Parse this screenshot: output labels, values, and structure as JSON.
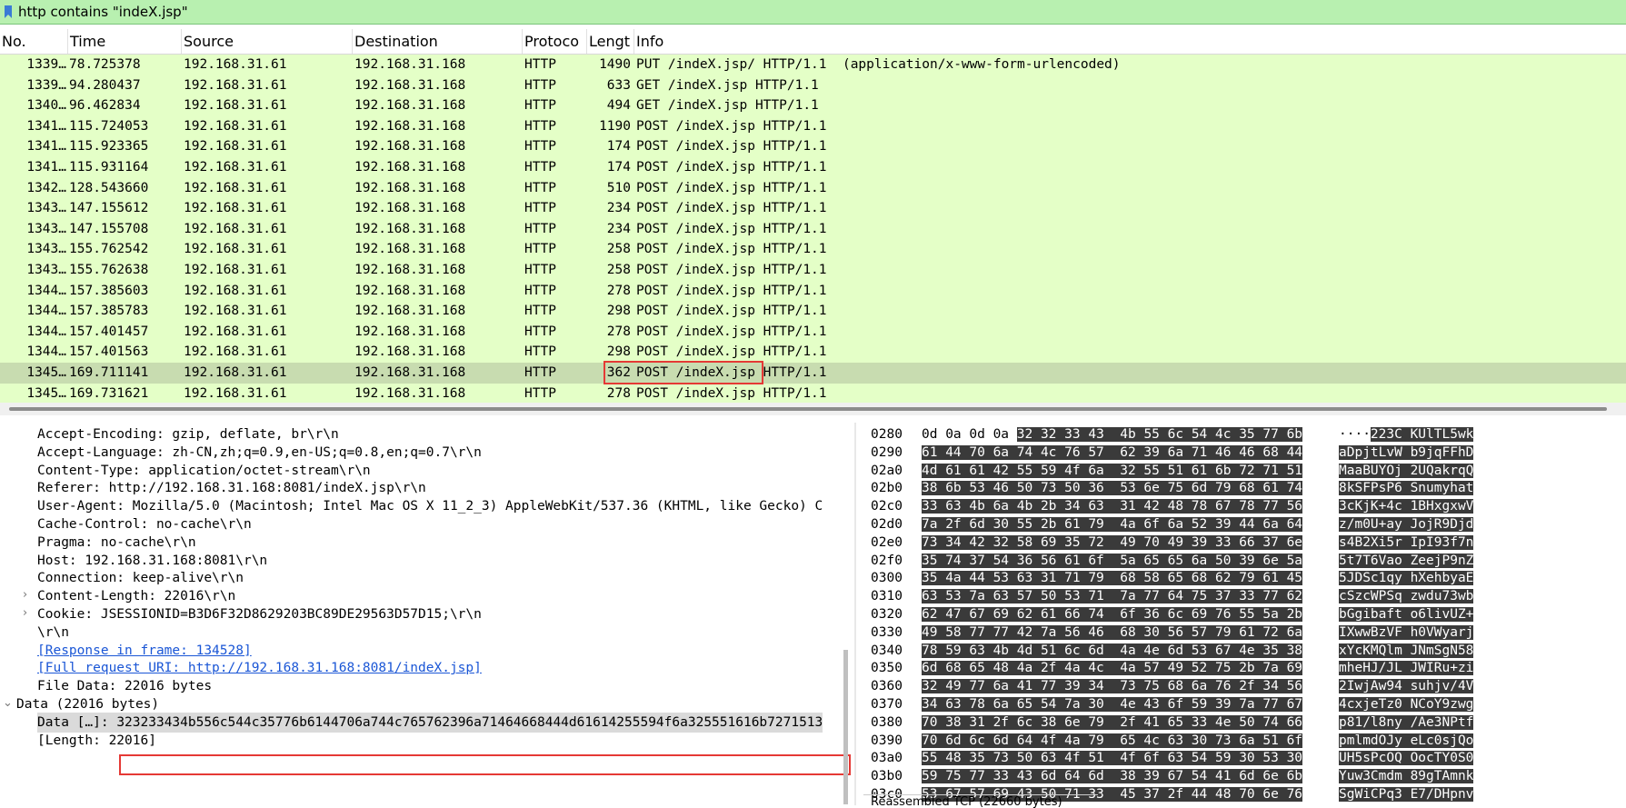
{
  "filter": {
    "text": "http contains \"indeX.jsp\""
  },
  "columns": [
    "No.",
    "Time",
    "Source",
    "Destination",
    "Protoco",
    "Lengt",
    "Info"
  ],
  "packets": [
    {
      "no": "1339…",
      "time": "78.725378",
      "src": "192.168.31.61",
      "dst": "192.168.31.168",
      "proto": "HTTP",
      "len": "1490",
      "info": "PUT /indeX.jsp/ HTTP/1.1  (application/x-www-form-urlencoded)"
    },
    {
      "no": "1339…",
      "time": "94.280437",
      "src": "192.168.31.61",
      "dst": "192.168.31.168",
      "proto": "HTTP",
      "len": "633",
      "info": "GET /indeX.jsp HTTP/1.1"
    },
    {
      "no": "1340…",
      "time": "96.462834",
      "src": "192.168.31.61",
      "dst": "192.168.31.168",
      "proto": "HTTP",
      "len": "494",
      "info": "GET /indeX.jsp HTTP/1.1"
    },
    {
      "no": "1341…",
      "time": "115.724053",
      "src": "192.168.31.61",
      "dst": "192.168.31.168",
      "proto": "HTTP",
      "len": "1190",
      "info": "POST /indeX.jsp HTTP/1.1"
    },
    {
      "no": "1341…",
      "time": "115.923365",
      "src": "192.168.31.61",
      "dst": "192.168.31.168",
      "proto": "HTTP",
      "len": "174",
      "info": "POST /indeX.jsp HTTP/1.1"
    },
    {
      "no": "1341…",
      "time": "115.931164",
      "src": "192.168.31.61",
      "dst": "192.168.31.168",
      "proto": "HTTP",
      "len": "174",
      "info": "POST /indeX.jsp HTTP/1.1"
    },
    {
      "no": "1342…",
      "time": "128.543660",
      "src": "192.168.31.61",
      "dst": "192.168.31.168",
      "proto": "HTTP",
      "len": "510",
      "info": "POST /indeX.jsp HTTP/1.1"
    },
    {
      "no": "1343…",
      "time": "147.155612",
      "src": "192.168.31.61",
      "dst": "192.168.31.168",
      "proto": "HTTP",
      "len": "234",
      "info": "POST /indeX.jsp HTTP/1.1"
    },
    {
      "no": "1343…",
      "time": "147.155708",
      "src": "192.168.31.61",
      "dst": "192.168.31.168",
      "proto": "HTTP",
      "len": "234",
      "info": "POST /indeX.jsp HTTP/1.1"
    },
    {
      "no": "1343…",
      "time": "155.762542",
      "src": "192.168.31.61",
      "dst": "192.168.31.168",
      "proto": "HTTP",
      "len": "258",
      "info": "POST /indeX.jsp HTTP/1.1"
    },
    {
      "no": "1343…",
      "time": "155.762638",
      "src": "192.168.31.61",
      "dst": "192.168.31.168",
      "proto": "HTTP",
      "len": "258",
      "info": "POST /indeX.jsp HTTP/1.1"
    },
    {
      "no": "1344…",
      "time": "157.385603",
      "src": "192.168.31.61",
      "dst": "192.168.31.168",
      "proto": "HTTP",
      "len": "278",
      "info": "POST /indeX.jsp HTTP/1.1"
    },
    {
      "no": "1344…",
      "time": "157.385783",
      "src": "192.168.31.61",
      "dst": "192.168.31.168",
      "proto": "HTTP",
      "len": "298",
      "info": "POST /indeX.jsp HTTP/1.1"
    },
    {
      "no": "1344…",
      "time": "157.401457",
      "src": "192.168.31.61",
      "dst": "192.168.31.168",
      "proto": "HTTP",
      "len": "278",
      "info": "POST /indeX.jsp HTTP/1.1"
    },
    {
      "no": "1344…",
      "time": "157.401563",
      "src": "192.168.31.61",
      "dst": "192.168.31.168",
      "proto": "HTTP",
      "len": "298",
      "info": "POST /indeX.jsp HTTP/1.1"
    },
    {
      "no": "1345…",
      "time": "169.711141",
      "src": "192.168.31.61",
      "dst": "192.168.31.168",
      "proto": "HTTP",
      "len": "362",
      "info": "POST /indeX.jsp HTTP/1.1",
      "selected": true
    },
    {
      "no": "1345…",
      "time": "169.731621",
      "src": "192.168.31.61",
      "dst": "192.168.31.168",
      "proto": "HTTP",
      "len": "278",
      "info": "POST /indeX.jsp HTTP/1.1"
    }
  ],
  "details": [
    {
      "indent": 1,
      "text": "Accept-Encoding: gzip, deflate, br\\r\\n"
    },
    {
      "indent": 1,
      "text": "Accept-Language: zh-CN,zh;q=0.9,en-US;q=0.8,en;q=0.7\\r\\n"
    },
    {
      "indent": 1,
      "text": "Content-Type: application/octet-stream\\r\\n"
    },
    {
      "indent": 1,
      "text": "Referer: http://192.168.31.168:8081/indeX.jsp\\r\\n"
    },
    {
      "indent": 1,
      "text": "User-Agent: Mozilla/5.0 (Macintosh; Intel Mac OS X 11_2_3) AppleWebKit/537.36 (KHTML, like Gecko) C"
    },
    {
      "indent": 1,
      "text": "Cache-Control: no-cache\\r\\n"
    },
    {
      "indent": 1,
      "text": "Pragma: no-cache\\r\\n"
    },
    {
      "indent": 1,
      "text": "Host: 192.168.31.168:8081\\r\\n"
    },
    {
      "indent": 1,
      "text": "Connection: keep-alive\\r\\n"
    },
    {
      "indent": 1,
      "text": "Content-Length: 22016\\r\\n",
      "expander": "›"
    },
    {
      "indent": 1,
      "text": "Cookie: JSESSIONID=B3D6F32D8629203BC89DE29563D57D15;\\r\\n",
      "expander": "›"
    },
    {
      "indent": 1,
      "text": "\\r\\n"
    },
    {
      "indent": 1,
      "text": "[Response in frame: 134528]",
      "link": true
    },
    {
      "indent": 1,
      "text": "[Full request URI: http://192.168.31.168:8081/indeX.jsp]",
      "link": true
    },
    {
      "indent": 1,
      "text": "File Data: 22016 bytes"
    },
    {
      "indent": 0,
      "text": "Data (22016 bytes)",
      "expander": "⌄"
    },
    {
      "indent": 1,
      "text": "Data […]: ",
      "value": "323233434b556c544c35776b6144706a744c765762396a71464668444d61614255594f6a325551616b7271513",
      "selected": true
    },
    {
      "indent": 1,
      "text": "[Length: 22016]"
    }
  ],
  "hex": [
    {
      "off": "0280",
      "bytes": "0d 0a 0d 0a 32 32 33 43  4b 55 6c 54 4c 35 77 6b",
      "ascii": "····223C KUlTL5wk"
    },
    {
      "off": "0290",
      "bytes": "61 44 70 6a 74 4c 76 57  62 39 6a 71 46 46 68 44",
      "ascii": "aDpjtLvW b9jqFFhD"
    },
    {
      "off": "02a0",
      "bytes": "4d 61 61 42 55 59 4f 6a  32 55 51 61 6b 72 71 51",
      "ascii": "MaaBUYOj 2UQakrqQ"
    },
    {
      "off": "02b0",
      "bytes": "38 6b 53 46 50 73 50 36  53 6e 75 6d 79 68 61 74",
      "ascii": "8kSFPsP6 Snumyhat"
    },
    {
      "off": "02c0",
      "bytes": "33 63 4b 6a 4b 2b 34 63  31 42 48 78 67 78 77 56",
      "ascii": "3cKjK+4c 1BHxgxwV"
    },
    {
      "off": "02d0",
      "bytes": "7a 2f 6d 30 55 2b 61 79  4a 6f 6a 52 39 44 6a 64",
      "ascii": "z/m0U+ay JojR9Djd"
    },
    {
      "off": "02e0",
      "bytes": "73 34 42 32 58 69 35 72  49 70 49 39 33 66 37 6e",
      "ascii": "s4B2Xi5r IpI93f7n"
    },
    {
      "off": "02f0",
      "bytes": "35 74 37 54 36 56 61 6f  5a 65 65 6a 50 39 6e 5a",
      "ascii": "5t7T6Vao ZeejP9nZ"
    },
    {
      "off": "0300",
      "bytes": "35 4a 44 53 63 31 71 79  68 58 65 68 62 79 61 45",
      "ascii": "5JDSc1qy hXehbyaE"
    },
    {
      "off": "0310",
      "bytes": "63 53 7a 63 57 50 53 71  7a 77 64 75 37 33 77 62",
      "ascii": "cSzcWPSq zwdu73wb"
    },
    {
      "off": "0320",
      "bytes": "62 47 67 69 62 61 66 74  6f 36 6c 69 76 55 5a 2b",
      "ascii": "bGgibaft o6livUZ+"
    },
    {
      "off": "0330",
      "bytes": "49 58 77 77 42 7a 56 46  68 30 56 57 79 61 72 6a",
      "ascii": "IXwwBzVF h0VWyarj"
    },
    {
      "off": "0340",
      "bytes": "78 59 63 4b 4d 51 6c 6d  4a 4e 6d 53 67 4e 35 38",
      "ascii": "xYcKMQlm JNmSgN58"
    },
    {
      "off": "0350",
      "bytes": "6d 68 65 48 4a 2f 4a 4c  4a 57 49 52 75 2b 7a 69",
      "ascii": "mheHJ/JL JWIRu+zi"
    },
    {
      "off": "0360",
      "bytes": "32 49 77 6a 41 77 39 34  73 75 68 6a 76 2f 34 56",
      "ascii": "2IwjAw94 suhjv/4V"
    },
    {
      "off": "0370",
      "bytes": "34 63 78 6a 65 54 7a 30  4e 43 6f 59 39 7a 77 67",
      "ascii": "4cxjeTz0 NCoY9zwg"
    },
    {
      "off": "0380",
      "bytes": "70 38 31 2f 6c 38 6e 79  2f 41 65 33 4e 50 74 66",
      "ascii": "p81/l8ny /Ae3NPtf"
    },
    {
      "off": "0390",
      "bytes": "70 6d 6c 6d 64 4f 4a 79  65 4c 63 30 73 6a 51 6f",
      "ascii": "pmlmdOJy eLc0sjQo"
    },
    {
      "off": "03a0",
      "bytes": "55 48 35 73 50 63 4f 51  4f 6f 63 54 59 30 53 30",
      "ascii": "UH5sPcOQ OocTY0S0"
    },
    {
      "off": "03b0",
      "bytes": "59 75 77 33 43 6d 64 6d  38 39 67 54 41 6d 6e 6b",
      "ascii": "Yuw3Cmdm 89gTAmnk"
    },
    {
      "off": "03c0",
      "bytes": "53 67 57 69 43 50 71 33  45 37 2f 44 48 70 6e 76",
      "ascii": "SgWiCPq3 E7/DHpnv"
    }
  ],
  "hex_tab": "Reassembled TCP (22660 bytes)"
}
